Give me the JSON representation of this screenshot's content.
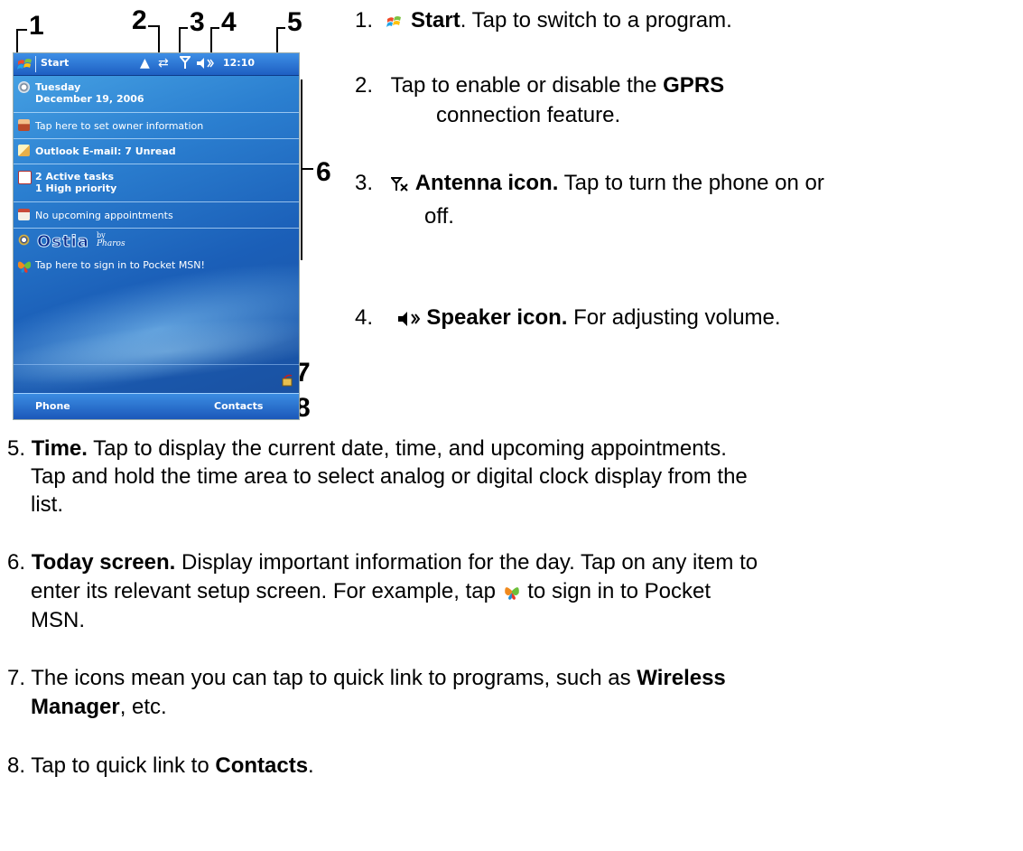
{
  "callouts": [
    "1",
    "2",
    "3",
    "4",
    "5",
    "6",
    "7",
    "8"
  ],
  "device": {
    "title": "Start",
    "time": "12:10",
    "rows": {
      "date_day": "Tuesday",
      "date_full": "December 19, 2006",
      "owner": "Tap here to set owner information",
      "email": "Outlook E-mail: 7 Unread",
      "tasks_line1": "2 Active tasks",
      "tasks_line2": "1 High priority",
      "appointments": "No upcoming appointments",
      "ostia_logo": "Ostia",
      "ostia_by": "by",
      "ostia_pharos": "Pharos",
      "msn": "Tap here to sign in to Pocket MSN!"
    },
    "softkeys": {
      "left": "Phone",
      "right": "Contacts"
    }
  },
  "items": [
    {
      "num": "1.",
      "bold": "Start",
      "text": ". Tap to switch to a program."
    },
    {
      "num": "2.",
      "text_a": "Tap to enable or disable the ",
      "bold": "GPRS",
      "text_b": "connection feature."
    },
    {
      "num": "3.",
      "bold": "Antenna icon.",
      "text": " Tap to turn the phone on or",
      "text_b": "off."
    },
    {
      "num": "4.",
      "bold": "Speaker icon.",
      "text": " For adjusting volume."
    },
    {
      "num": "5.",
      "bold": "Time.",
      "text": " Tap to display the current date, time, and upcoming appointments.",
      "text_b": "Tap and hold the time area to select analog or digital clock display from the",
      "text_c": "list."
    },
    {
      "num": "6.",
      "bold": "Today screen.",
      "text": " Display important information for the day. Tap on any item to",
      "text_b": "enter its relevant setup screen. For example, tap",
      "text_c": " to sign in to Pocket",
      "text_d": "MSN."
    },
    {
      "num": "7.",
      "text": " The icons mean you can tap to quick link to programs, such as ",
      "bold": "Wireless",
      "bold_b": "Manager",
      "text_b": ", etc."
    },
    {
      "num": "8.",
      "text": " Tap to quick link to ",
      "bold": "Contacts",
      "text_b": "."
    }
  ]
}
